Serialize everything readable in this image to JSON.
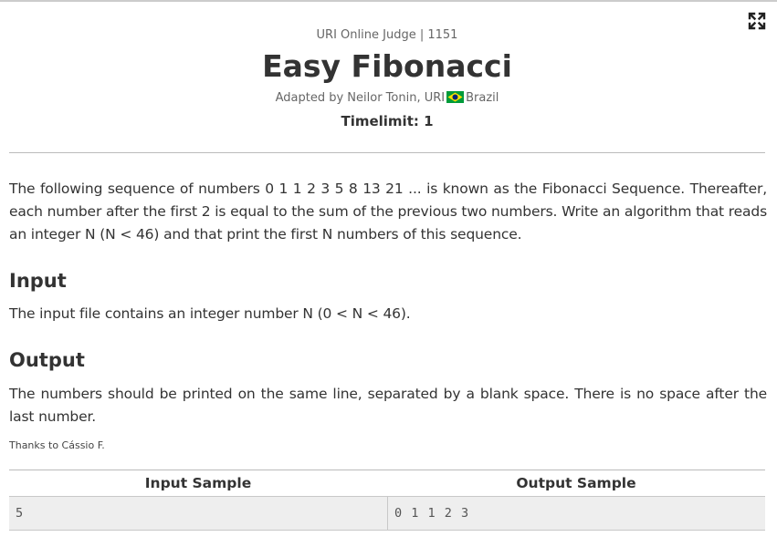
{
  "problem": {
    "judge_line": "URI Online Judge | 1151",
    "title": "Easy Fibonacci",
    "author_prefix": "Adapted by Neilor Tonin, URI",
    "country": "Brazil",
    "timelimit": "Timelimit: 1"
  },
  "description": "The following sequence of numbers 0 1 1 2 3 5 8 13 21 ... is known as the Fibonacci Sequence. Thereafter, each number after the first 2 is equal to the sum of the previous two numbers. Write an algorithm that reads an integer N (N < 46) and that print the first N numbers of this sequence.",
  "input": {
    "heading": "Input",
    "text": "The input file contains an integer number N (0 < N < 46)."
  },
  "output": {
    "heading": "Output",
    "text": "The numbers should be printed on the same line, separated by a blank space. There is no space after the last number."
  },
  "thanks": "Thanks to Cássio F.",
  "samples": {
    "input_header": "Input Sample",
    "output_header": "Output Sample",
    "input_value": "5",
    "output_value": "0 1 1 2 3"
  },
  "icons": {
    "expand": "expand-icon",
    "flag": "brazil-flag-icon"
  },
  "colors": {
    "text": "#333333",
    "muted": "#666666",
    "sample_bg": "#eeeeee",
    "flag_green": "#009b3a",
    "flag_yellow": "#fedf00",
    "flag_blue": "#002776"
  }
}
